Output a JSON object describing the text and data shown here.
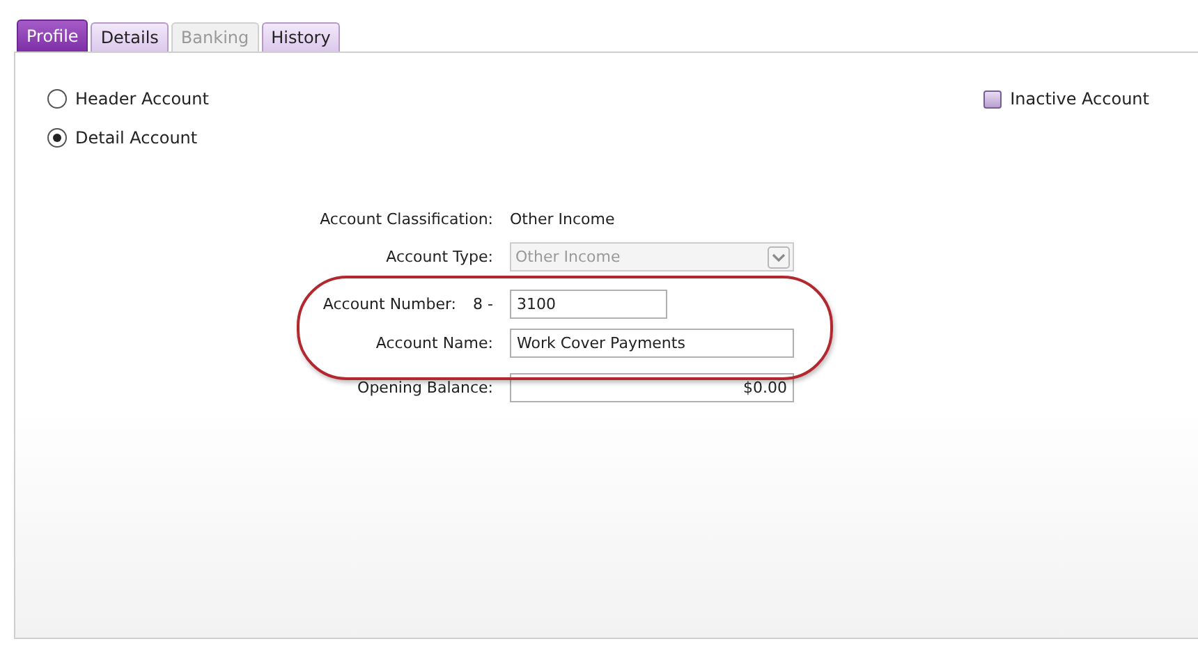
{
  "tabs": [
    {
      "label": "Profile",
      "selected": true,
      "disabled": false
    },
    {
      "label": "Details",
      "selected": false,
      "disabled": false
    },
    {
      "label": "Banking",
      "selected": false,
      "disabled": true
    },
    {
      "label": "History",
      "selected": false,
      "disabled": false
    }
  ],
  "account_kind": [
    {
      "label": "Header Account",
      "selected": false
    },
    {
      "label": "Detail Account",
      "selected": true
    }
  ],
  "inactive_account": {
    "label": "Inactive Account",
    "checked": false
  },
  "form": {
    "classification": {
      "label": "Account Classification:",
      "value": "Other Income"
    },
    "account_type": {
      "label": "Account Type:",
      "value": "Other Income",
      "disabled": true
    },
    "account_number": {
      "label": "Account Number:",
      "prefix": "8 -",
      "value": "3100"
    },
    "account_name": {
      "label": "Account Name:",
      "value": "Work Cover Payments"
    },
    "opening_balance": {
      "label": "Opening Balance:",
      "value": "$0.00"
    }
  },
  "highlight": {
    "visible": true
  }
}
